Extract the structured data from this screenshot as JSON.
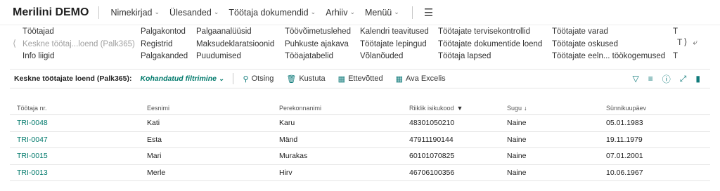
{
  "header": {
    "company": "Merilini DEMO",
    "menu": [
      {
        "label": "Nimekirjad"
      },
      {
        "label": "Ülesanded"
      },
      {
        "label": "Töötaja dokumendid"
      },
      {
        "label": "Arhiiv"
      },
      {
        "label": "Menüü"
      }
    ],
    "hamburger_icon": "hamburger-icon"
  },
  "actions": {
    "col1": [
      "Töötajad",
      "Keskne töötaj...loend (Palk365)",
      "Info liigid"
    ],
    "col2": [
      "Palgakontod",
      "Registrid",
      "Palgakanded"
    ],
    "col3": [
      "Palgaanalüüsid",
      "Maksudeklaratsioonid",
      "Puudumised"
    ],
    "col4": [
      "Töövõimetuslehed",
      "Puhkuste ajakava",
      "Tööajatabelid"
    ],
    "col5": [
      "Kalendri teavitused",
      "Töötajate lepingud",
      "Võlanõuded"
    ],
    "col6": [
      "Töötajate tervisekontrollid",
      "Töötajate dokumentide loend",
      "Töötaja lapsed"
    ],
    "col7": [
      "Töötajate varad",
      "Töötajate oskused",
      "Töötajate eeln... töökogemused"
    ],
    "col8": [
      "T",
      "T",
      "T"
    ]
  },
  "toolbar": {
    "title": "Keskne töötajate loend (Palk365):",
    "filter": "Kohandatud filtrimine",
    "buttons": [
      {
        "label": "Otsing",
        "icon": "search-icon"
      },
      {
        "label": "Kustuta",
        "icon": "delete-icon"
      },
      {
        "label": "Ettevõtted",
        "icon": "building-icon"
      },
      {
        "label": "Ava Excelis",
        "icon": "excel-icon"
      }
    ]
  },
  "table": {
    "headers": [
      "Töötaja nr.",
      "Eesnimi",
      "Perekonnanimi",
      "Riiklik isikukood",
      "Sugu",
      "Sünnikuupäev"
    ],
    "rows": [
      [
        "TRI-0048",
        "Kati",
        "Karu",
        "48301050210",
        "Naine",
        "05.01.1983"
      ],
      [
        "TRI-0047",
        "Esta",
        "Mänd",
        "47911190144",
        "Naine",
        "19.11.1979"
      ],
      [
        "TRI-0015",
        "Mari",
        "Murakas",
        "60101070825",
        "Naine",
        "07.01.2001"
      ],
      [
        "TRI-0013",
        "Merle",
        "Hirv",
        "46706100356",
        "Naine",
        "10.06.1967"
      ]
    ]
  },
  "colors": {
    "accent": "#00796b",
    "icon": "#0f7a7a"
  }
}
